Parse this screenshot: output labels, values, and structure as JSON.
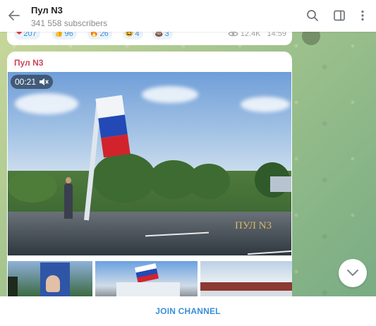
{
  "header": {
    "title": "Пул N3",
    "subscribers": "341 558 subscribers",
    "icons": [
      "back-arrow-icon",
      "search-icon",
      "sidebar-icon",
      "more-vertical-icon"
    ]
  },
  "prev_message": {
    "reactions": [
      {
        "emoji": "heart",
        "count": "207",
        "color": "#e53935"
      },
      {
        "emoji": "thumbs-up",
        "count": "96",
        "color": "#f5b400"
      },
      {
        "emoji": "fire",
        "count": "26",
        "color": "#ff7a00"
      },
      {
        "emoji": "laughing",
        "count": "4",
        "color": "#f5b400"
      },
      {
        "emoji": "poop",
        "count": "3",
        "color": "#3cb14a"
      }
    ],
    "views": "12.4K",
    "time": "14:59"
  },
  "post": {
    "author": "Пул N3",
    "duration": "00:21",
    "watermark": "ПУЛ N3"
  },
  "footer": {
    "join_label": "JOIN CHANNEL"
  },
  "colors": {
    "accent": "#3a8fd8",
    "author": "#d0455b"
  }
}
